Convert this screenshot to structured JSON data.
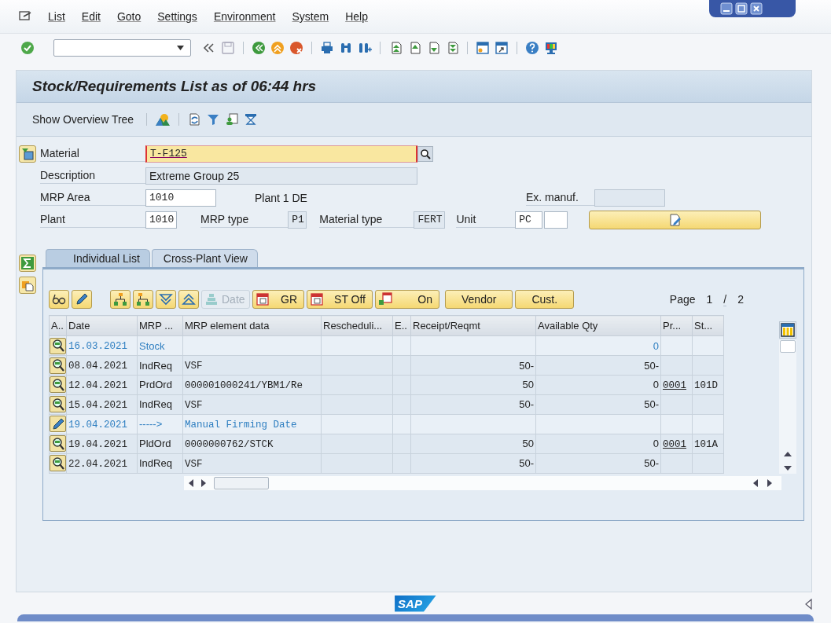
{
  "menu": [
    "List",
    "Edit",
    "Goto",
    "Settings",
    "Environment",
    "System",
    "Help"
  ],
  "screen": {
    "title": "Stock/Requirements List as of 06:44 hrs",
    "overview_button": "Show Overview Tree"
  },
  "header": {
    "material": {
      "label": "Material",
      "value": "T-F125",
      "focused": true
    },
    "description": {
      "label": "Description",
      "value": "Extreme Group 25",
      "readonly": true
    },
    "mrp_area": {
      "label": "MRP Area",
      "value": "1010",
      "text": "Plant 1 DE",
      "readonly": false
    },
    "ex_manuf": {
      "label": "Ex. manuf.",
      "readonly": true
    },
    "plant": {
      "label": "Plant",
      "value": "1010",
      "readonly": false
    },
    "mrp_type": {
      "label": "MRP type",
      "value": "P1",
      "readonly": true
    },
    "material_type": {
      "label": "Material type",
      "value": "FERT",
      "readonly": true
    },
    "unit": {
      "label": "Unit",
      "value": "PC",
      "readonly": false
    }
  },
  "tabs": [
    {
      "label": "Individual List",
      "selected": true
    },
    {
      "label": "Cross-Plant View",
      "selected": false
    }
  ],
  "list_toolbar": [
    {
      "kind": "icon",
      "disabled": false
    },
    {
      "kind": "icon",
      "disabled": false
    },
    {
      "kind": "icon",
      "disabled": false
    },
    {
      "kind": "icon",
      "disabled": false
    },
    {
      "kind": "icon",
      "disabled": false
    },
    {
      "kind": "icon",
      "disabled": false
    },
    {
      "kind": "icon_text",
      "label": "Date",
      "disabled": true
    },
    {
      "kind": "icon_text",
      "label": "GR",
      "disabled": false
    },
    {
      "kind": "icon_text",
      "label": "ST Off",
      "disabled": false
    },
    {
      "kind": "icon_text",
      "label": "On",
      "disabled": false
    },
    {
      "kind": "text",
      "label": "Vendor",
      "disabled": false
    },
    {
      "kind": "text",
      "label": "Cust.",
      "disabled": false
    }
  ],
  "page": {
    "label": "Page",
    "current": "1",
    "separator": "/",
    "total": "2"
  },
  "table": {
    "columns": [
      "A..",
      "Date",
      "MRP ...",
      "MRP element data",
      "Rescheduli...",
      "E..",
      "Receipt/Reqmt",
      "Available Qty",
      "Pr...",
      "St..."
    ],
    "rows": [
      {
        "kind": "stock",
        "date": "16.03.2021",
        "mrp_element": "Stock",
        "available": "0"
      },
      {
        "kind": "element",
        "date": "08.04.2021",
        "mrp_element": "IndReq",
        "element_data": "VSF",
        "receipt": "50-",
        "available": "50-"
      },
      {
        "kind": "element",
        "date": "12.04.2021",
        "mrp_element": "PrdOrd",
        "element_data": "000001000241/YBM1/Re",
        "receipt": "50",
        "available": "0",
        "column_9": "0001",
        "column_10": "101D"
      },
      {
        "kind": "element",
        "date": "15.04.2021",
        "mrp_element": "IndReq",
        "element_data": "VSF",
        "receipt": "50-",
        "available": "50-"
      },
      {
        "kind": "firming",
        "date": "19.04.2021",
        "mrp_element": "----->",
        "element_data": "Manual Firming Date"
      },
      {
        "kind": "element",
        "date": "19.04.2021",
        "mrp_element": "PldOrd",
        "element_data": "0000000762/STCK",
        "receipt": "50",
        "available": "0",
        "column_9": "0001",
        "column_10": "101A"
      },
      {
        "kind": "element",
        "date": "22.04.2021",
        "mrp_element": "IndReq",
        "element_data": "VSF",
        "receipt": "50-",
        "available": "50-"
      }
    ]
  },
  "footer": {
    "logo": "SAP"
  }
}
